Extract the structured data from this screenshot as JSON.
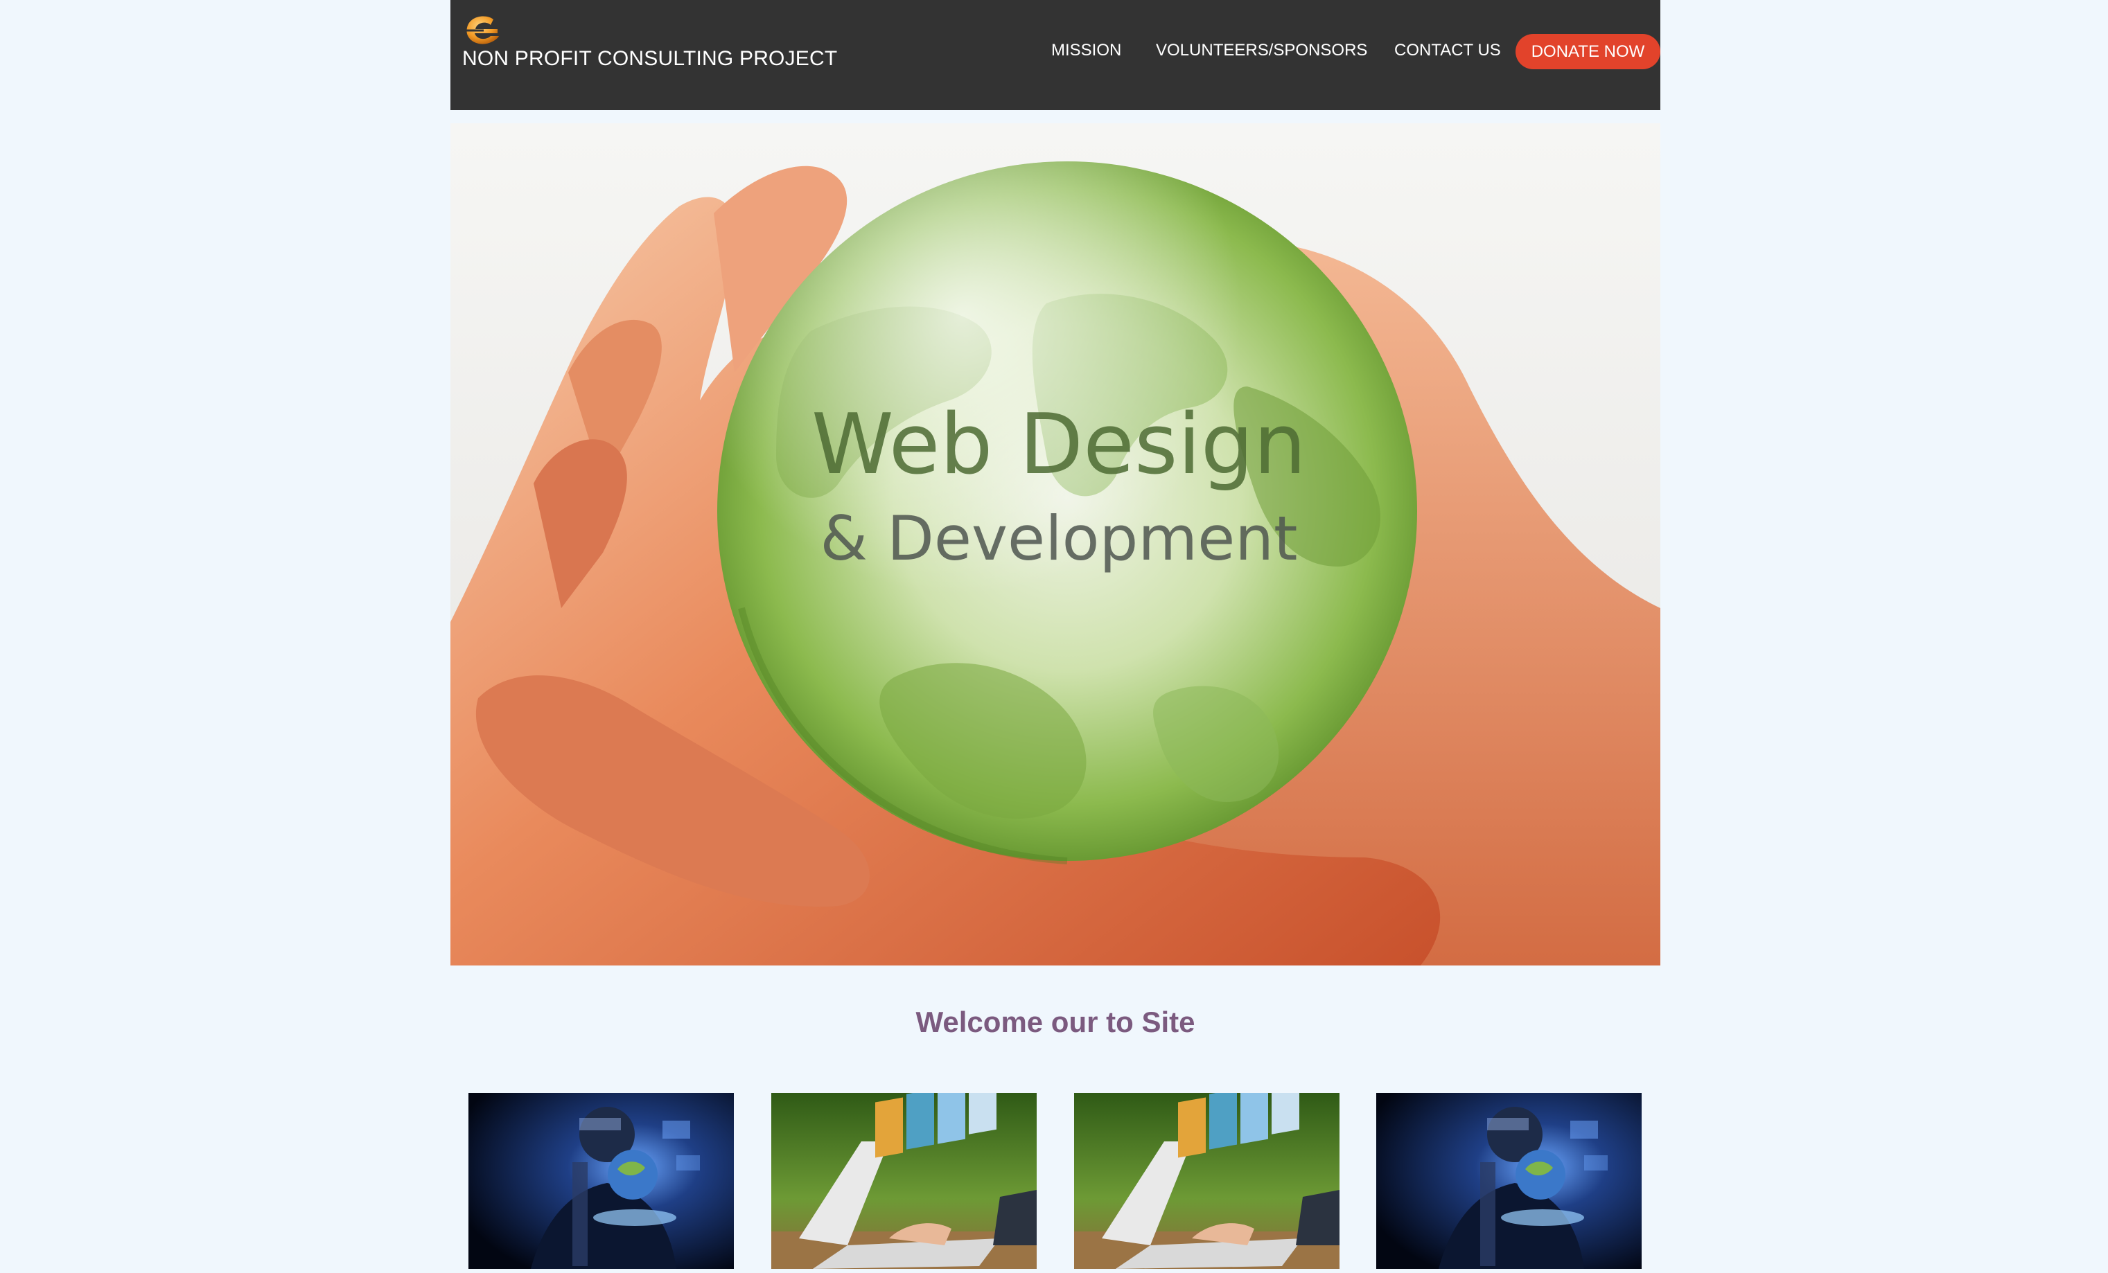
{
  "header": {
    "site_title": "NON PROFIT CONSULTING PROJECT",
    "logo_icon": "orange-e-logo-icon",
    "bg_color": "#333333"
  },
  "nav": {
    "items": [
      {
        "label": "MISSION"
      },
      {
        "label": "VOLUNTEERS/SPONSORS"
      },
      {
        "label": "CONTACT US"
      }
    ],
    "donate_label": "DONATE NOW",
    "donate_color": "#e2432b"
  },
  "hero": {
    "line1": "Web Design",
    "line2": "& Development"
  },
  "main": {
    "welcome": "Welcome our to Site",
    "welcome_color": "#7b5a7f"
  },
  "thumbnails": [
    {
      "image": "businessman-globe-image"
    },
    {
      "image": "laptop-websites-image"
    },
    {
      "image": "laptop-websites-image"
    },
    {
      "image": "businessman-globe-image"
    }
  ]
}
